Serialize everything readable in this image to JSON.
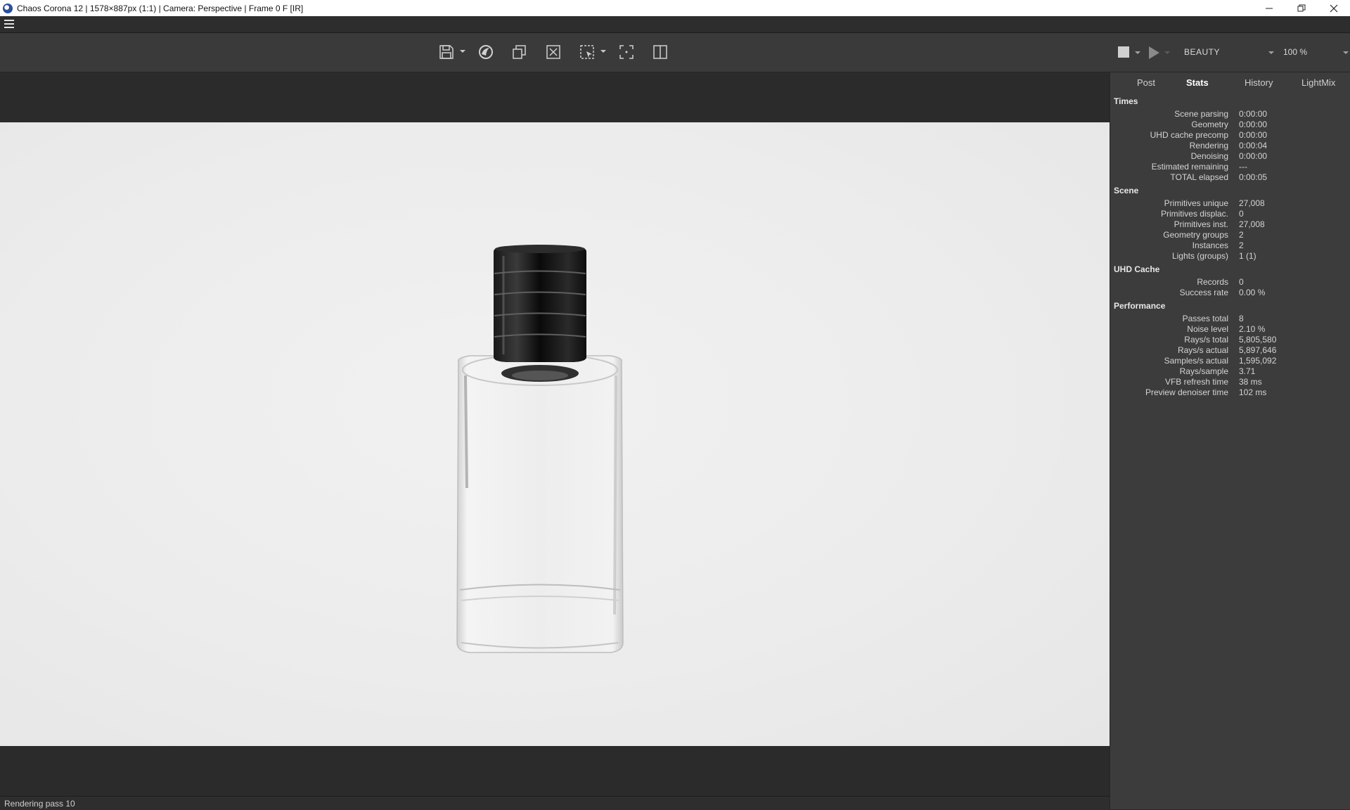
{
  "window": {
    "title": "Chaos Corona 12 | 1578×887px (1:1) | Camera: Perspective | Frame 0 F [IR]",
    "app_icon": "corona-logo-icon",
    "controls": [
      "minimize-icon",
      "restore-icon",
      "close-icon"
    ]
  },
  "menubar": {
    "menu_icon": "hamburger-menu-icon"
  },
  "toolbar": {
    "tools": [
      {
        "name": "save-icon",
        "has_dropdown": true
      },
      {
        "name": "corona-image-editor-icon",
        "has_dropdown": false
      },
      {
        "name": "copy-to-clipboard-icon",
        "has_dropdown": false
      },
      {
        "name": "clear-icon",
        "has_dropdown": false
      },
      {
        "name": "region-select-icon",
        "has_dropdown": true
      },
      {
        "name": "focus-icon",
        "has_dropdown": false
      },
      {
        "name": "split-view-icon",
        "has_dropdown": false
      }
    ],
    "render_stop_icon": "stop-icon",
    "render_start_icon": "play-icon",
    "channel": "BEAUTY",
    "zoom": "100 %"
  },
  "panel": {
    "tabs": [
      {
        "label": "Post",
        "active": false
      },
      {
        "label": "Stats",
        "active": true
      },
      {
        "label": "History",
        "active": false
      },
      {
        "label": "LightMix",
        "active": false
      }
    ],
    "sections": [
      {
        "title": "Times",
        "rows": [
          {
            "label": "Scene parsing",
            "value": "0:00:00"
          },
          {
            "label": "Geometry",
            "value": "0:00:00"
          },
          {
            "label": "UHD cache precomp",
            "value": "0:00:00"
          },
          {
            "label": "Rendering",
            "value": "0:00:04"
          },
          {
            "label": "Denoising",
            "value": "0:00:00"
          },
          {
            "label": "Estimated remaining",
            "value": "---"
          },
          {
            "label": "TOTAL elapsed",
            "value": "0:00:05"
          }
        ]
      },
      {
        "title": "Scene",
        "rows": [
          {
            "label": "Primitives unique",
            "value": "27,008"
          },
          {
            "label": "Primitives displac.",
            "value": "0"
          },
          {
            "label": "Primitives inst.",
            "value": "27,008"
          },
          {
            "label": "Geometry groups",
            "value": "2"
          },
          {
            "label": "Instances",
            "value": "2"
          },
          {
            "label": "Lights (groups)",
            "value": "1 (1)"
          }
        ]
      },
      {
        "title": "UHD Cache",
        "rows": [
          {
            "label": "Records",
            "value": "0"
          },
          {
            "label": "Success rate",
            "value": "0.00 %"
          }
        ]
      },
      {
        "title": "Performance",
        "rows": [
          {
            "label": "Passes total",
            "value": "8"
          },
          {
            "label": "Noise level",
            "value": "2.10 %"
          },
          {
            "label": "Rays/s total",
            "value": "5,805,580"
          },
          {
            "label": "Rays/s actual",
            "value": "5,897,646"
          },
          {
            "label": "Samples/s actual",
            "value": "1,595,092"
          },
          {
            "label": "Rays/sample",
            "value": "3.71"
          },
          {
            "label": "VFB refresh time",
            "value": "38 ms"
          },
          {
            "label": "Preview denoiser time",
            "value": "102 ms"
          }
        ]
      }
    ]
  },
  "status": {
    "text": "Rendering pass 10"
  }
}
